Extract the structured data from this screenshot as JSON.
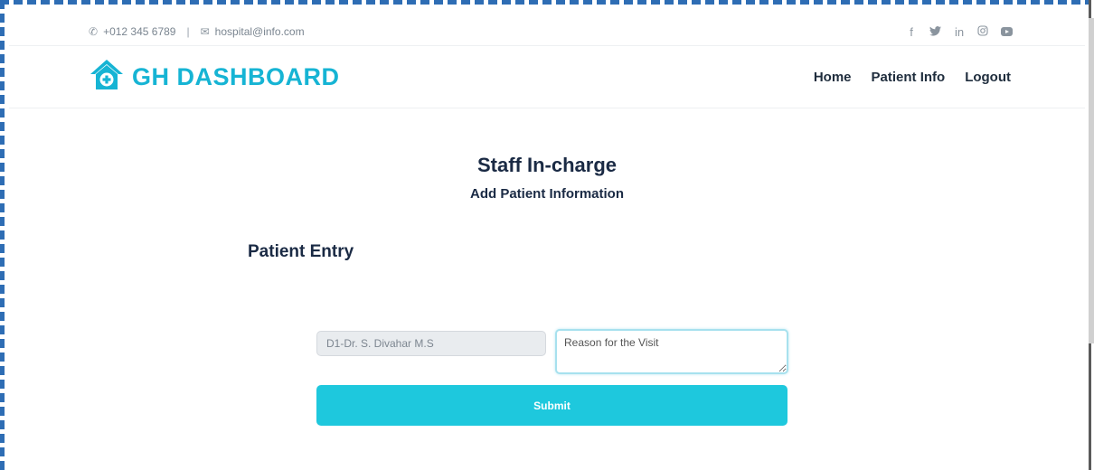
{
  "topbar": {
    "phone": "+012 345 6789",
    "separator": "|",
    "email": "hospital@info.com",
    "phone_icon": "phone-icon",
    "email_icon": "envelope-icon",
    "social": {
      "facebook": "f",
      "twitter": "twitter-icon",
      "linkedin": "in",
      "instagram": "instagram-icon",
      "youtube": "youtube-icon"
    }
  },
  "brand": {
    "name": "GH DASHBOARD",
    "icon": "home-plus-icon",
    "color": "#16b4d4"
  },
  "nav": {
    "items": [
      {
        "label": "Home"
      },
      {
        "label": "Patient Info"
      },
      {
        "label": "Logout"
      }
    ]
  },
  "page": {
    "title": "Staff In-charge",
    "subtitle": "Add Patient Information",
    "section_title": "Patient Entry"
  },
  "form": {
    "doctor_value": "D1-Dr. S. Divahar M.S",
    "reason_placeholder": "Reason for the Visit",
    "submit_label": "Submit",
    "accent_color": "#1ec8dd"
  }
}
